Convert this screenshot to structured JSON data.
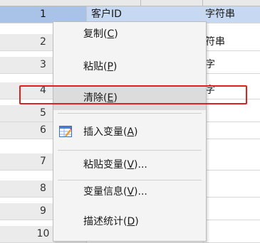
{
  "data_view": {
    "rows": [
      {
        "num": "1",
        "col1": "客户ID",
        "col2": "字符串",
        "selected": true
      },
      {
        "num": "2",
        "col1": "",
        "col2": "符串",
        "selected": false
      },
      {
        "num": "3",
        "col1": "",
        "col2": "字",
        "selected": false
      },
      {
        "num": "4",
        "col1": "",
        "col2": "字",
        "selected": false
      },
      {
        "num": "5",
        "col1": "",
        "col2": "",
        "selected": false
      },
      {
        "num": "6",
        "col1": "",
        "col2": "",
        "selected": false
      },
      {
        "num": "7",
        "col1": "",
        "col2": "",
        "selected": false
      },
      {
        "num": "8",
        "col1": "",
        "col2": "",
        "selected": false
      },
      {
        "num": "9",
        "col1": "",
        "col2": "",
        "selected": false
      },
      {
        "num": "10",
        "col1": "",
        "col2": "",
        "selected": false
      }
    ]
  },
  "context_menu": {
    "items": [
      {
        "label": "复制(",
        "key": "C",
        "suffix": ")"
      },
      {
        "label": "粘贴(",
        "key": "P",
        "suffix": ")"
      },
      {
        "label": "清除(",
        "key": "E",
        "suffix": ")",
        "highlighted": true
      },
      {
        "label": "插入变量(",
        "key": "A",
        "suffix": ")",
        "icon": "insert-variable-icon"
      },
      {
        "label": "粘贴变量(",
        "key": "V",
        "suffix": ")..."
      },
      {
        "label": "变量信息(",
        "key": "V",
        "suffix": ")..."
      },
      {
        "label": "描述统计(",
        "key": "D",
        "suffix": ")"
      }
    ]
  },
  "annotation": {
    "color": "#e0201d",
    "target": "清除(E)"
  },
  "colors": {
    "selected_row": "#a9c2e8",
    "menu_bg": "#f4f4f4",
    "menu_highlight": "#dcdcdc"
  }
}
